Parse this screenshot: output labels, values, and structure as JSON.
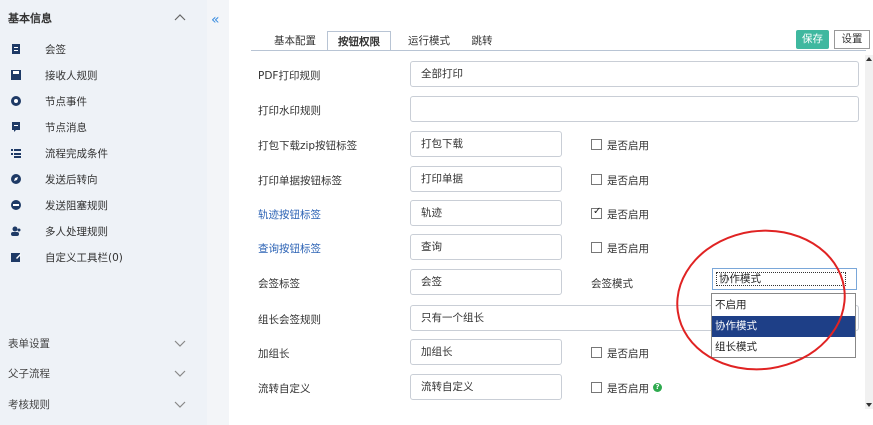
{
  "sidebar": {
    "header": "基本信息",
    "items": [
      {
        "label": "会签",
        "icon": "document-icon"
      },
      {
        "label": "接收人规则",
        "icon": "save-icon"
      },
      {
        "label": "节点事件",
        "icon": "gear-icon"
      },
      {
        "label": "节点消息",
        "icon": "message-icon"
      },
      {
        "label": "流程完成条件",
        "icon": "list-icon"
      },
      {
        "label": "发送后转向",
        "icon": "compass-icon"
      },
      {
        "label": "发送阻塞规则",
        "icon": "minus-circle-icon"
      },
      {
        "label": "多人处理规则",
        "icon": "users-icon"
      },
      {
        "label": "自定义工具栏(0)",
        "icon": "edit-icon"
      }
    ],
    "sections": [
      {
        "label": "表单设置"
      },
      {
        "label": "父子流程"
      },
      {
        "label": "考核规则"
      }
    ],
    "collapse_glyph": "«"
  },
  "tabs": [
    {
      "label": "基本配置"
    },
    {
      "label": "按钮权限"
    },
    {
      "label": "运行模式"
    },
    {
      "label": "跳转"
    }
  ],
  "toolbar": {
    "save_label": "保存",
    "settings_label": "设置"
  },
  "rows": [
    {
      "label": "PDF打印规则",
      "value": "全部打印"
    },
    {
      "label": "打印水印规则",
      "value": ""
    },
    {
      "label": "打包下载zip按钮标签",
      "value": "打包下载",
      "check_label": "是否启用"
    },
    {
      "label": "打印单据按钮标签",
      "value": "打印单据",
      "check_label": "是否启用"
    },
    {
      "label": "轨迹按钮标签",
      "value": "轨迹",
      "check_label": "是否启用"
    },
    {
      "label": "查询按钮标签",
      "value": "查询",
      "check_label": "是否启用"
    },
    {
      "label": "会签标签",
      "value": "会签",
      "mode_label": "会签模式",
      "mode_value": "协作模式"
    },
    {
      "label": "组长会签规则",
      "value": "只有一个组长"
    },
    {
      "label": "加组长",
      "value": "加组长",
      "check_label": "是否启用"
    },
    {
      "label": "流转自定义",
      "value": "流转自定义",
      "check_label": "是否启用"
    }
  ],
  "mode_options": [
    {
      "label": "不启用"
    },
    {
      "label": "协作模式"
    },
    {
      "label": "组长模式"
    }
  ],
  "colors": {
    "accent": "#3fb89f",
    "highlight": "#1e3f87",
    "annotation": "#e02323"
  }
}
